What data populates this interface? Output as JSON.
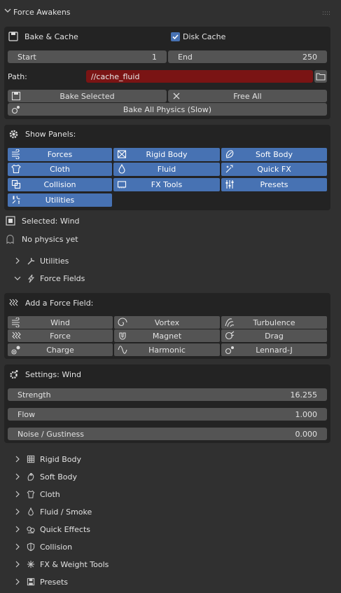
{
  "header": {
    "title": "Force Awakens"
  },
  "bake": {
    "title": "Bake & Cache",
    "disk_cache_label": "Disk Cache",
    "disk_cache_checked": true,
    "start_label": "Start",
    "start_value": "1",
    "end_label": "End",
    "end_value": "250",
    "path_label": "Path:",
    "path_value": "//cache_fluid",
    "bake_selected": "Bake Selected",
    "free_all": "Free All",
    "bake_all": "Bake All Physics (Slow)"
  },
  "panels": {
    "title": "Show Panels:",
    "items": [
      {
        "label": "Forces",
        "icon": "forces-icon"
      },
      {
        "label": "Rigid Body",
        "icon": "rigid-body-icon"
      },
      {
        "label": "Soft Body",
        "icon": "soft-body-icon"
      },
      {
        "label": "Cloth",
        "icon": "cloth-icon"
      },
      {
        "label": "Fluid",
        "icon": "fluid-icon"
      },
      {
        "label": "Quick FX",
        "icon": "quick-fx-icon"
      },
      {
        "label": "Collision",
        "icon": "collision-icon"
      },
      {
        "label": "FX Tools",
        "icon": "fx-tools-icon"
      },
      {
        "label": "Presets",
        "icon": "presets-icon"
      },
      {
        "label": "Utilities",
        "icon": "utilities-icon"
      }
    ]
  },
  "selected": {
    "label": "Selected: Wind",
    "status": "No physics yet"
  },
  "tree_top": [
    {
      "label": "Utilities",
      "expanded": false
    },
    {
      "label": "Force Fields",
      "expanded": true
    }
  ],
  "force_field": {
    "title": "Add a Force Field:",
    "items": [
      {
        "label": "Wind",
        "icon": "wind-icon"
      },
      {
        "label": "Vortex",
        "icon": "vortex-icon"
      },
      {
        "label": "Turbulence",
        "icon": "turbulence-icon"
      },
      {
        "label": "Force",
        "icon": "force-icon"
      },
      {
        "label": "Magnet",
        "icon": "magnet-icon"
      },
      {
        "label": "Drag",
        "icon": "drag-icon"
      },
      {
        "label": "Charge",
        "icon": "charge-icon"
      },
      {
        "label": "Harmonic",
        "icon": "harmonic-icon"
      },
      {
        "label": "Lennard-J",
        "icon": "lennard-j-icon"
      }
    ]
  },
  "settings": {
    "title": "Settings: Wind",
    "fields": [
      {
        "label": "Strength",
        "value": "16.255"
      },
      {
        "label": "Flow",
        "value": "1.000"
      },
      {
        "label": "Noise / Gustiness",
        "value": "0.000"
      }
    ]
  },
  "tree_bottom": [
    {
      "label": "Rigid Body"
    },
    {
      "label": "Soft Body"
    },
    {
      "label": "Cloth"
    },
    {
      "label": "Fluid / Smoke"
    },
    {
      "label": "Quick Effects"
    },
    {
      "label": "Collision"
    },
    {
      "label": "FX & Weight Tools"
    },
    {
      "label": "Presets"
    }
  ]
}
